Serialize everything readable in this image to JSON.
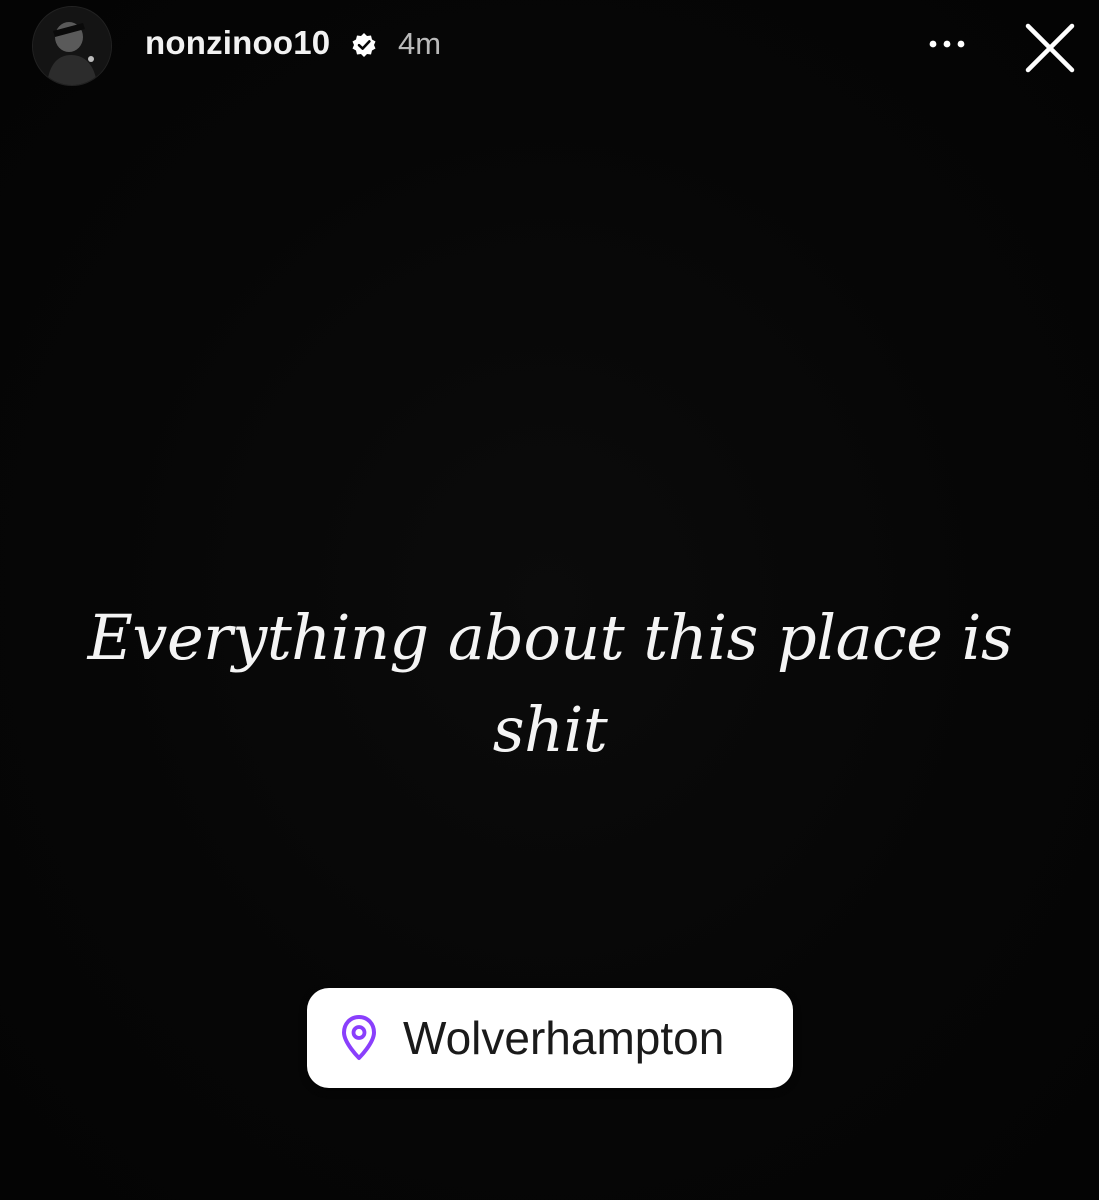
{
  "header": {
    "username": "nonzinoo10",
    "verified_icon": "verified-badge-icon",
    "time": "4m",
    "more_icon": "more-options-icon",
    "close_icon": "close-icon"
  },
  "story": {
    "caption": "Everything about this place is shit",
    "background_color": "#050505",
    "text_color": "#f4f4f4"
  },
  "location_sticker": {
    "icon": "location-pin-icon",
    "label": "Wolverhampton",
    "icon_color": "#8a3ffc",
    "background_color": "#ffffff"
  }
}
